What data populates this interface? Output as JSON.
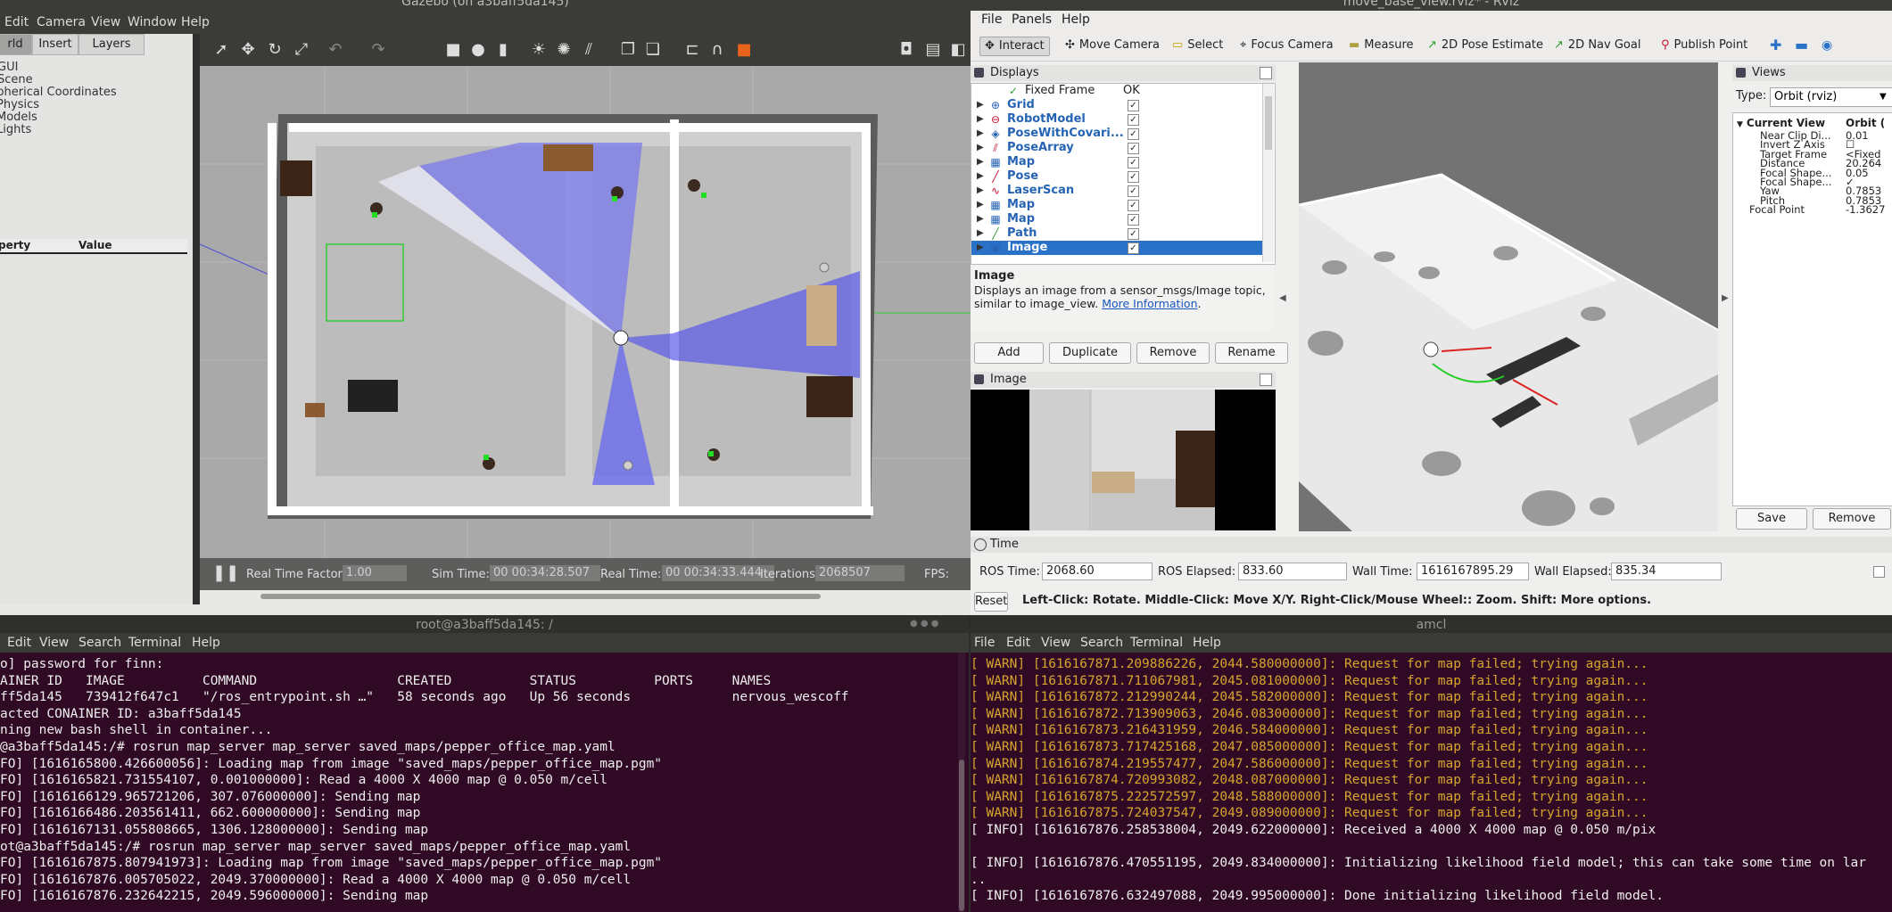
{
  "gazebo": {
    "title": "Gazebo (on a3baff5da145)",
    "menu": [
      "Edit",
      "Camera",
      "View",
      "Window",
      "Help"
    ],
    "tabs": [
      "rld",
      "Insert",
      "Layers"
    ],
    "tree_items": [
      "GUI",
      "Scene",
      "Spherical Coordinates",
      "Physics",
      "Models",
      "Lights"
    ],
    "prop_header": {
      "property": "perty",
      "value": "Value"
    },
    "bottom": {
      "rtf_label": "Real Time Factor:",
      "rtf": "1.00",
      "sim_label": "Sim Time:",
      "sim": "00 00:34:28.507",
      "real_label": "Real Time:",
      "real": "00 00:34:33.444",
      "iter_label": "Iterations:",
      "iter": "2068507",
      "fps_label": "FPS:"
    }
  },
  "rviz": {
    "title": "move_base_view.rviz* - RViz",
    "menu": [
      "File",
      "Panels",
      "Help"
    ],
    "tools": [
      {
        "label": "Interact",
        "icon": "✥"
      },
      {
        "label": "Move Camera",
        "icon": "✣"
      },
      {
        "label": "Select",
        "icon": "▭"
      },
      {
        "label": "Focus Camera",
        "icon": "⌖"
      },
      {
        "label": "Measure",
        "icon": "▬"
      },
      {
        "label": "2D Pose Estimate",
        "icon": "↗"
      },
      {
        "label": "2D Nav Goal",
        "icon": "↗"
      },
      {
        "label": "Publish Point",
        "icon": "⚲"
      }
    ],
    "displays_title": "Displays",
    "fixed_frame": {
      "label": "Fixed Frame",
      "value": "OK"
    },
    "displays": [
      {
        "name": "Grid",
        "icon": "⊕",
        "color": "#2564b5"
      },
      {
        "name": "RobotModel",
        "icon": "⊖",
        "color": "#c8102e"
      },
      {
        "name": "PoseWithCovari...",
        "icon": "◈",
        "color": "#2564b5"
      },
      {
        "name": "PoseArray",
        "icon": "⫽",
        "color": "#c8102e"
      },
      {
        "name": "Map",
        "icon": "▦",
        "color": "#2564b5"
      },
      {
        "name": "Pose",
        "icon": "╱",
        "color": "#c8102e"
      },
      {
        "name": "LaserScan",
        "icon": "∿",
        "color": "#c8102e"
      },
      {
        "name": "Map",
        "icon": "▦",
        "color": "#2564b5"
      },
      {
        "name": "Map",
        "icon": "▦",
        "color": "#2564b5"
      },
      {
        "name": "Path",
        "icon": "╱",
        "color": "#2d9b2d"
      },
      {
        "name": "Image",
        "icon": "▣",
        "color": "#2564b5"
      }
    ],
    "desc_title": "Image",
    "desc_text": "Displays an image from a sensor_msgs/Image topic, similar to image_view.",
    "desc_link": "More Information",
    "desc_end": ".",
    "buttons": [
      "Add",
      "Duplicate",
      "Remove",
      "Rename"
    ],
    "image_panel_title": "Image",
    "views_title": "Views",
    "type_label": "Type:",
    "type_value": "Orbit (rviz)",
    "view_head": {
      "name": "Current View",
      "value": "Orbit ("
    },
    "view_props": [
      {
        "name": "Near Clip Di...",
        "value": "0.01"
      },
      {
        "name": "Invert Z Axis",
        "value": "☐"
      },
      {
        "name": "Target Frame",
        "value": "<Fixed"
      },
      {
        "name": "Distance",
        "value": "20.264"
      },
      {
        "name": "Focal Shape...",
        "value": "0.05"
      },
      {
        "name": "Focal Shape...",
        "value": "✓"
      },
      {
        "name": "Yaw",
        "value": "0.7853"
      },
      {
        "name": "Pitch",
        "value": "0.7853"
      },
      {
        "name": "Focal Point",
        "value": "-1.3627"
      }
    ],
    "view_buttons": [
      "Save",
      "Remove"
    ],
    "time_title": "Time",
    "time": {
      "ros_time_label": "ROS Time:",
      "ros_time": "2068.60",
      "ros_elapsed_label": "ROS Elapsed:",
      "ros_elapsed": "833.60",
      "wall_time_label": "Wall Time:",
      "wall_time": "1616167895.29",
      "wall_elapsed_label": "Wall Elapsed:",
      "wall_elapsed": "835.34"
    },
    "status": {
      "reset": "Reset",
      "hint": "Left-Click: Rotate. Middle-Click: Move X/Y. Right-Click/Mouse Wheel:: Zoom. Shift: More options."
    }
  },
  "terminal_left": {
    "title": "root@a3baff5da145: /",
    "menu": [
      "Edit",
      "View",
      "Search",
      "Terminal",
      "Help"
    ],
    "lines": [
      "o] password for finn:",
      "AINER ID   IMAGE          COMMAND                  CREATED          STATUS          PORTS     NAMES",
      "ff5da145   739412f647c1   \"/ros_entrypoint.sh …\"   58 seconds ago   Up 56 seconds             nervous_wescoff",
      "acted CONAINER ID: a3baff5da145",
      "ning new bash shell in container...",
      "@a3baff5da145:/# rosrun map_server map_server saved_maps/pepper_office_map.yaml",
      "FO] [1616165800.426600056]: Loading map from image \"saved_maps/pepper_office_map.pgm\"",
      "FO] [1616165821.731554107, 0.001000000]: Read a 4000 X 4000 map @ 0.050 m/cell",
      "FO] [1616166129.965721206, 307.076000000]: Sending map",
      "FO] [1616166486.203561411, 662.600000000]: Sending map",
      "FO] [1616167131.055808665, 1306.128000000]: Sending map",
      "ot@a3baff5da145:/# rosrun map_server map_server saved_maps/pepper_office_map.yaml",
      "FO] [1616167875.807941973]: Loading map from image \"saved_maps/pepper_office_map.pgm\"",
      "FO] [1616167876.005705022, 2049.370000000]: Read a 4000 X 4000 map @ 0.050 m/cell",
      "FO] [1616167876.232642215, 2049.596000000]: Sending map"
    ]
  },
  "terminal_right": {
    "title": "amcl",
    "menu": [
      "File",
      "Edit",
      "View",
      "Search",
      "Terminal",
      "Help"
    ],
    "lines": [
      {
        "text": "[ WARN] [1616167871.209886226, 2044.580000000]: Request for map failed; trying again...",
        "warn": true
      },
      {
        "text": "[ WARN] [1616167871.711067981, 2045.081000000]: Request for map failed; trying again...",
        "warn": true
      },
      {
        "text": "[ WARN] [1616167872.212990244, 2045.582000000]: Request for map failed; trying again...",
        "warn": true
      },
      {
        "text": "[ WARN] [1616167872.713909063, 2046.083000000]: Request for map failed; trying again...",
        "warn": true
      },
      {
        "text": "[ WARN] [1616167873.216431959, 2046.584000000]: Request for map failed; trying again...",
        "warn": true
      },
      {
        "text": "[ WARN] [1616167873.717425168, 2047.085000000]: Request for map failed; trying again...",
        "warn": true
      },
      {
        "text": "[ WARN] [1616167874.219557477, 2047.586000000]: Request for map failed; trying again...",
        "warn": true
      },
      {
        "text": "[ WARN] [1616167874.720993082, 2048.087000000]: Request for map failed; trying again...",
        "warn": true
      },
      {
        "text": "[ WARN] [1616167875.222572597, 2048.588000000]: Request for map failed; trying again...",
        "warn": true
      },
      {
        "text": "[ WARN] [1616167875.724037547, 2049.089000000]: Request for map failed; trying again...",
        "warn": true
      },
      {
        "text": "[ INFO] [1616167876.258538004, 2049.622000000]: Received a 4000 X 4000 map @ 0.050 m/pix",
        "warn": false
      },
      {
        "text": "",
        "warn": false
      },
      {
        "text": "[ INFO] [1616167876.470551195, 2049.834000000]: Initializing likelihood field model; this can take some time on lar",
        "warn": false
      },
      {
        "text": "..",
        "warn": false
      },
      {
        "text": "[ INFO] [1616167876.632497088, 2049.995000000]: Done initializing likelihood field model.",
        "warn": false
      }
    ]
  }
}
